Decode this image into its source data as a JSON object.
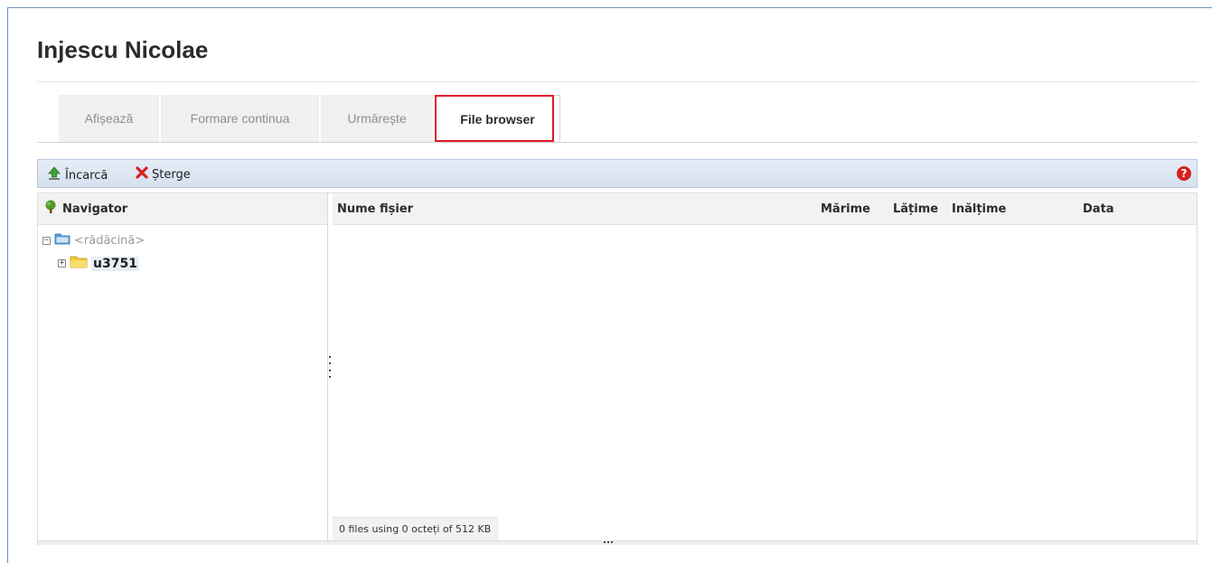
{
  "page": {
    "title": "Injescu Nicolae"
  },
  "tabs": [
    {
      "label": "Afișează"
    },
    {
      "label": "Formare continua"
    },
    {
      "label": "Urmărește"
    },
    {
      "label": "File browser",
      "active": true
    }
  ],
  "toolbar": {
    "upload_label": "Încarcă",
    "upload_icon": "upload-arrow-icon",
    "delete_label": "Șterge",
    "delete_icon": "red-x-icon",
    "help_icon": "help-icon",
    "help_glyph": "?"
  },
  "navigator": {
    "header": "Navigator",
    "header_icon": "tree-icon",
    "tree": [
      {
        "label": "<rădăcină>",
        "expander": "−",
        "icon": "folder-blue-icon"
      },
      {
        "label": "u3751",
        "expander": "+",
        "icon": "folder-yellow-icon",
        "selected": true
      }
    ]
  },
  "files": {
    "columns": {
      "name": "Nume fișier",
      "size": "Mărime",
      "width": "Lățime",
      "height": "Inălțime",
      "date": "Data"
    },
    "rows": [],
    "status": "0 files using 0 octeți of 512 KB"
  },
  "colors": {
    "tab_highlight": "#e0192a",
    "toolbar_bg": "#dbe4f1",
    "help": "#d6201c"
  }
}
